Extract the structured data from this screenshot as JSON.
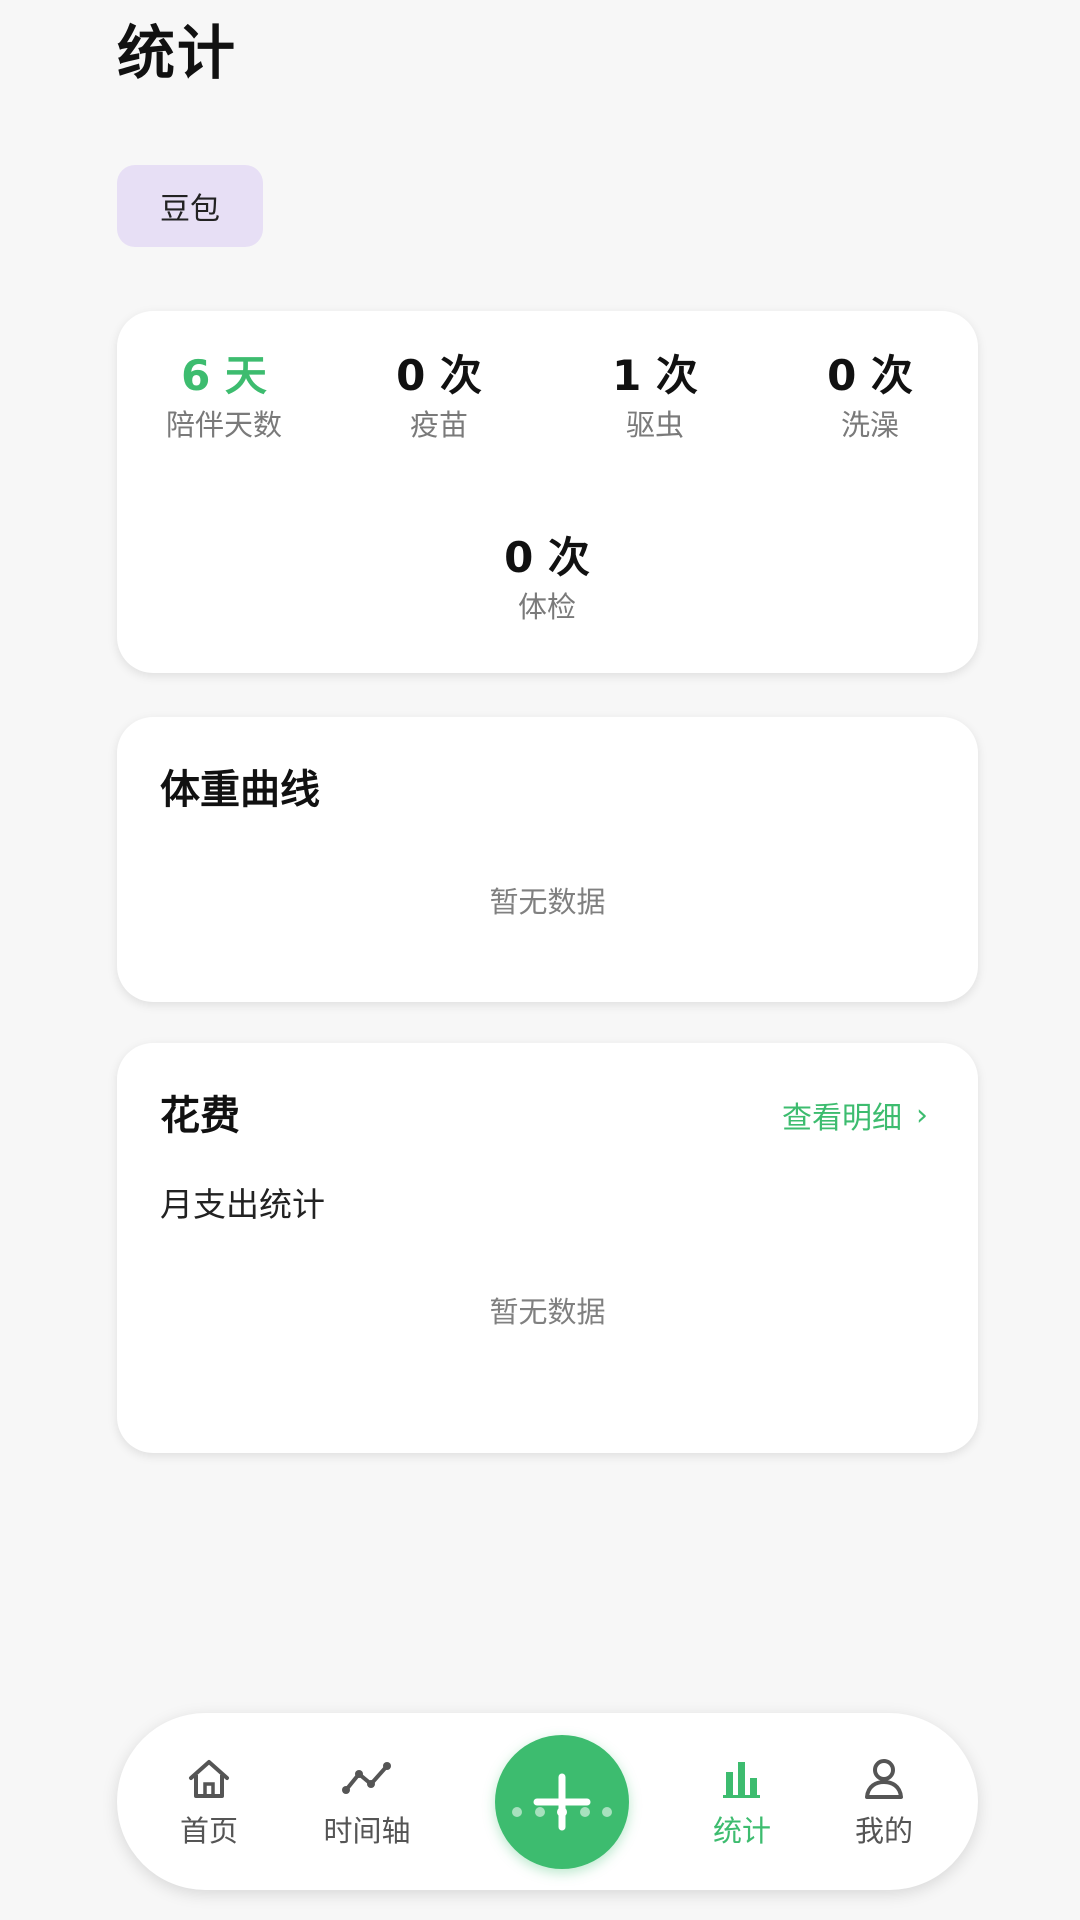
{
  "page": {
    "title": "统计"
  },
  "pet": {
    "name": "豆包"
  },
  "stats": [
    {
      "value": "6 天",
      "label": "陪伴天数"
    },
    {
      "value": "0 次",
      "label": "疫苗"
    },
    {
      "value": "1 次",
      "label": "驱虫"
    },
    {
      "value": "0 次",
      "label": "洗澡"
    },
    {
      "value": "0 次",
      "label": "体检"
    }
  ],
  "weight": {
    "title": "体重曲线",
    "empty": "暂无数据"
  },
  "cost": {
    "title": "花费",
    "link": "查看明细",
    "subtitle": "月支出统计",
    "empty": "暂无数据"
  },
  "tabs": [
    {
      "label": "首页",
      "icon": "home-icon"
    },
    {
      "label": "时间轴",
      "icon": "timeline-icon"
    },
    {
      "label": "统计",
      "icon": "bar-chart-icon",
      "active": true
    },
    {
      "label": "我的",
      "icon": "user-icon"
    }
  ],
  "colors": {
    "accent": "#3dbc6f",
    "chip": "#e7dff5",
    "background": "#f7f7f7"
  }
}
